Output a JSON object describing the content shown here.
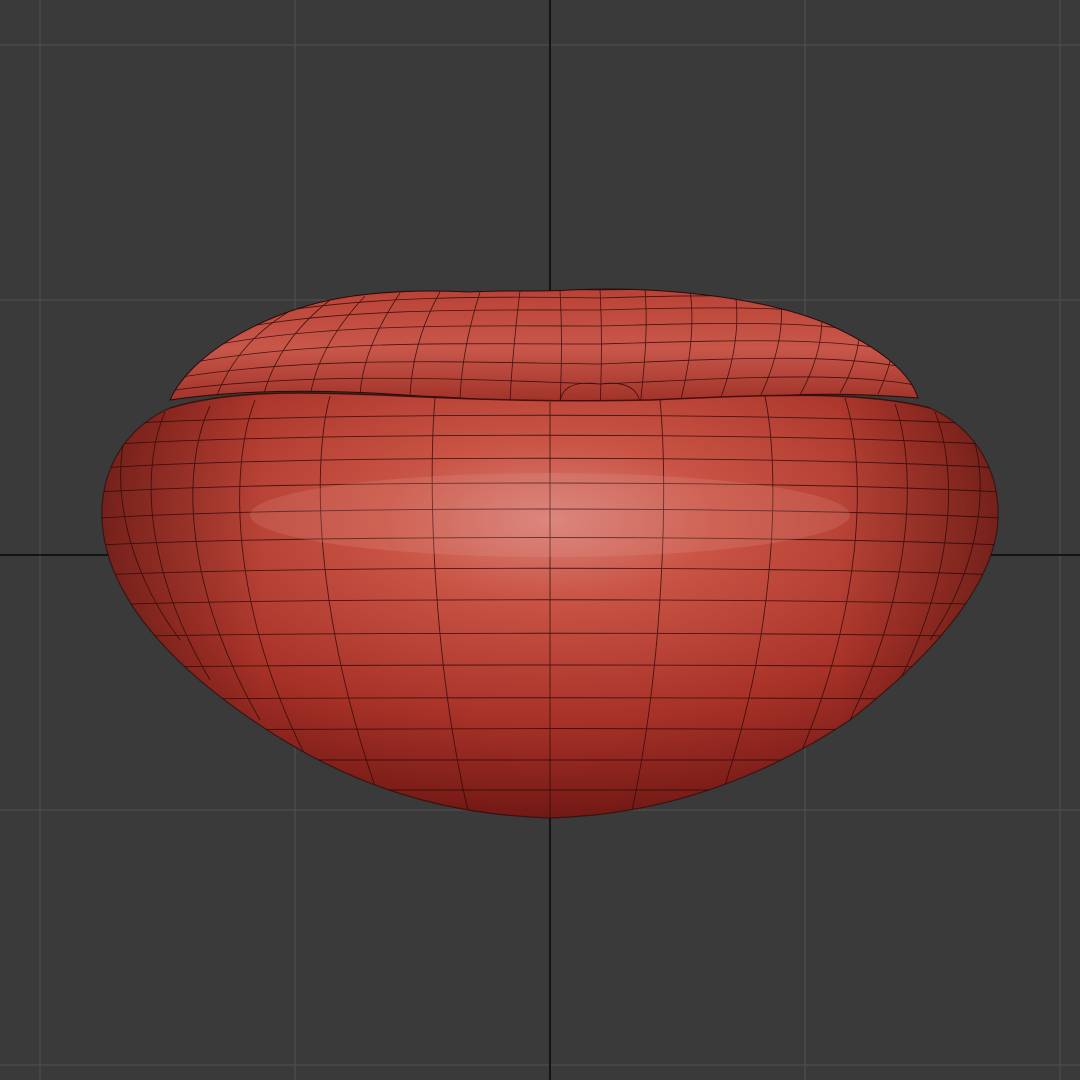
{
  "viewport": {
    "view": "front",
    "background_color": "#3a3a3a",
    "grid": {
      "visible": true,
      "minor_line_color": "#4b4b4b",
      "axis_line_color": "#141414"
    },
    "mesh": {
      "shape": "rounded pillow / cushion",
      "material_color": "#c4493c",
      "highlight_color": "#d77a70",
      "shadow_color": "#5a0f0f",
      "wireframe_visible": true,
      "wireframe_color": "#2a0a08"
    }
  }
}
